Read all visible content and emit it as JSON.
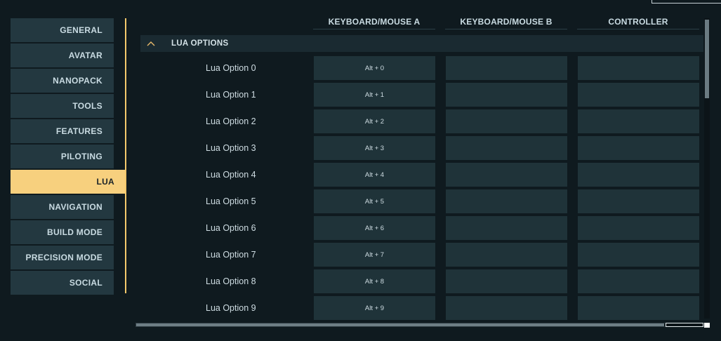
{
  "sidebar": {
    "items": [
      {
        "label": "GENERAL",
        "active": false
      },
      {
        "label": "AVATAR",
        "active": false
      },
      {
        "label": "NANOPACK",
        "active": false
      },
      {
        "label": "TOOLS",
        "active": false
      },
      {
        "label": "FEATURES",
        "active": false
      },
      {
        "label": "PILOTING",
        "active": false
      },
      {
        "label": "LUA",
        "active": true
      },
      {
        "label": "NAVIGATION",
        "active": false
      },
      {
        "label": "BUILD MODE",
        "active": false
      },
      {
        "label": "PRECISION MODE",
        "active": false
      },
      {
        "label": "SOCIAL",
        "active": false
      }
    ]
  },
  "columns": [
    "KEYBOARD/MOUSE A",
    "KEYBOARD/MOUSE B",
    "CONTROLLER"
  ],
  "section": {
    "title": "LUA OPTIONS",
    "icon": "chevron-up-icon"
  },
  "rows": [
    {
      "label": "Lua Option 0",
      "kbm_a": "Alt + 0",
      "kbm_b": "",
      "controller": ""
    },
    {
      "label": "Lua Option 1",
      "kbm_a": "Alt + 1",
      "kbm_b": "",
      "controller": ""
    },
    {
      "label": "Lua Option 2",
      "kbm_a": "Alt + 2",
      "kbm_b": "",
      "controller": ""
    },
    {
      "label": "Lua Option 3",
      "kbm_a": "Alt + 3",
      "kbm_b": "",
      "controller": ""
    },
    {
      "label": "Lua Option 4",
      "kbm_a": "Alt + 4",
      "kbm_b": "",
      "controller": ""
    },
    {
      "label": "Lua Option 5",
      "kbm_a": "Alt + 5",
      "kbm_b": "",
      "controller": ""
    },
    {
      "label": "Lua Option 6",
      "kbm_a": "Alt + 6",
      "kbm_b": "",
      "controller": ""
    },
    {
      "label": "Lua Option 7",
      "kbm_a": "Alt + 7",
      "kbm_b": "",
      "controller": ""
    },
    {
      "label": "Lua Option 8",
      "kbm_a": "Alt + 8",
      "kbm_b": "",
      "controller": ""
    },
    {
      "label": "Lua Option 9",
      "kbm_a": "Alt + 9",
      "kbm_b": "",
      "controller": ""
    }
  ],
  "colors": {
    "background": "#0f1a1f",
    "sidebar_item": "#233840",
    "active_accent": "#f7d07e",
    "bind_box": "#1f3339",
    "section_bar": "#1a2a31"
  }
}
